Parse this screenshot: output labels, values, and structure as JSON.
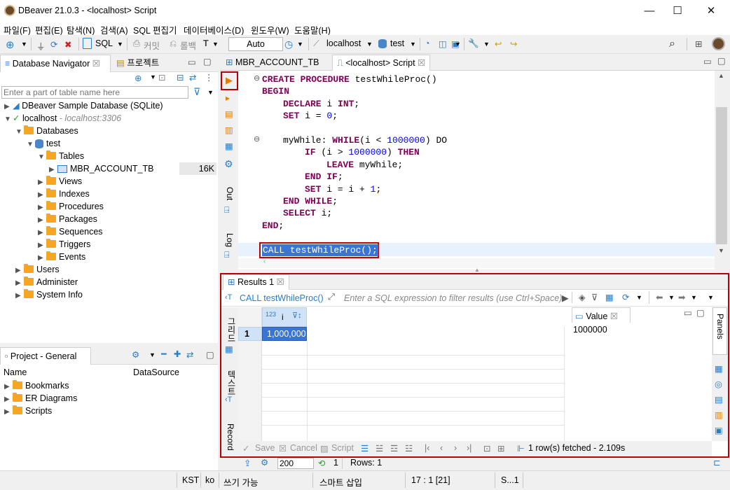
{
  "window": {
    "title": "DBeaver 21.0.3 - <localhost> Script",
    "minimize": "—",
    "maximize": "☐",
    "close": "✕"
  },
  "menu": [
    "파일(F)",
    "편집(E)",
    "탐색(N)",
    "검색(A)",
    "SQL 편집기",
    "데이터베이스(D)",
    "윈도우(W)",
    "도움말(H)"
  ],
  "toolbar": {
    "sql": "SQL",
    "commit": "커밋",
    "rollback": "롤백",
    "auto": "Auto",
    "connection": "localhost",
    "database": "test"
  },
  "navigator": {
    "tab_label": "Database Navigator",
    "project_tab": "프로젝트",
    "filter_placeholder": "Enter a part of table name here",
    "tree": {
      "sample_db": "DBeaver Sample Database (SQLite)",
      "localhost": "localhost",
      "localhost_host": "- localhost:3306",
      "databases": "Databases",
      "test": "test",
      "tables": "Tables",
      "table": "MBR_ACCOUNT_TB",
      "table_size": "16K",
      "folders": [
        "Views",
        "Indexes",
        "Procedures",
        "Packages",
        "Sequences",
        "Triggers",
        "Events"
      ],
      "users": "Users",
      "administer": "Administer",
      "system_info": "System Info"
    }
  },
  "project": {
    "tab_label": "Project - General",
    "col_name": "Name",
    "col_datasource": "DataSource",
    "items": [
      "Bookmarks",
      "ER Diagrams",
      "Scripts"
    ]
  },
  "editor": {
    "tabs": [
      "MBR_ACCOUNT_TB",
      "<localhost> Script"
    ],
    "side_out": "Out",
    "side_log": "Log",
    "lines": {
      "l1_kw": "CREATE PROCEDURE",
      "l1_rest": " testWhileProc()",
      "l2": "BEGIN",
      "l3_kw": "DECLARE",
      "l3_mid": " i ",
      "l3_kw2": "INT",
      "l3_end": ";",
      "l4_kw": "SET",
      "l4_mid": " i = ",
      "l4_num": "0",
      "l4_end": ";",
      "l5_a": "myWhile: ",
      "l5_kw": "WHILE",
      "l5_b": "(i < ",
      "l5_num": "1000000",
      "l5_c": ") DO",
      "l6_kw": "IF",
      "l6_a": " (i > ",
      "l6_num": "1000000",
      "l6_b": ") ",
      "l6_kw2": "THEN",
      "l7_kw": "LEAVE",
      "l7_a": " myWhile;",
      "l8_kw": "END IF",
      "l8_end": ";",
      "l9_kw": "SET",
      "l9_a": " i = i + ",
      "l9_num": "1",
      "l9_end": ";",
      "l10_kw": "END WHILE",
      "l10_end": ";",
      "l11_kw": "SELECT",
      "l11_a": " i;",
      "l12_kw": "END",
      "l12_end": ";",
      "call": "CALL testWhileProc();"
    }
  },
  "results": {
    "tab_label": "Results 1",
    "query": "CALL testWhileProc()",
    "filter_placeholder": "Enter a SQL expression to filter results (use Ctrl+Space)",
    "side_grid": "그리드",
    "side_text": "텍스트",
    "side_record": "Record",
    "column_type": "123",
    "column": "i",
    "rows": [
      {
        "num": "1",
        "value": "1,000,000"
      }
    ],
    "value_panel_title": "Value",
    "value": "1000000",
    "panels_label": "Panels",
    "save": "Save",
    "cancel": "Cancel",
    "script": "Script",
    "fetched": "1 row(s) fetched - 2.109s",
    "fetch_size": "200",
    "rows_label": "Rows: 1",
    "refresh_count": "1"
  },
  "status": {
    "tz": "KST",
    "lang": "ko",
    "mode": "쓰기 가능",
    "insert": "스마트 삽입",
    "pos": "17 : 1 [21]",
    "sel": "S...1"
  },
  "colors": {
    "accent": "#c00000",
    "selection": "#3875d7"
  }
}
